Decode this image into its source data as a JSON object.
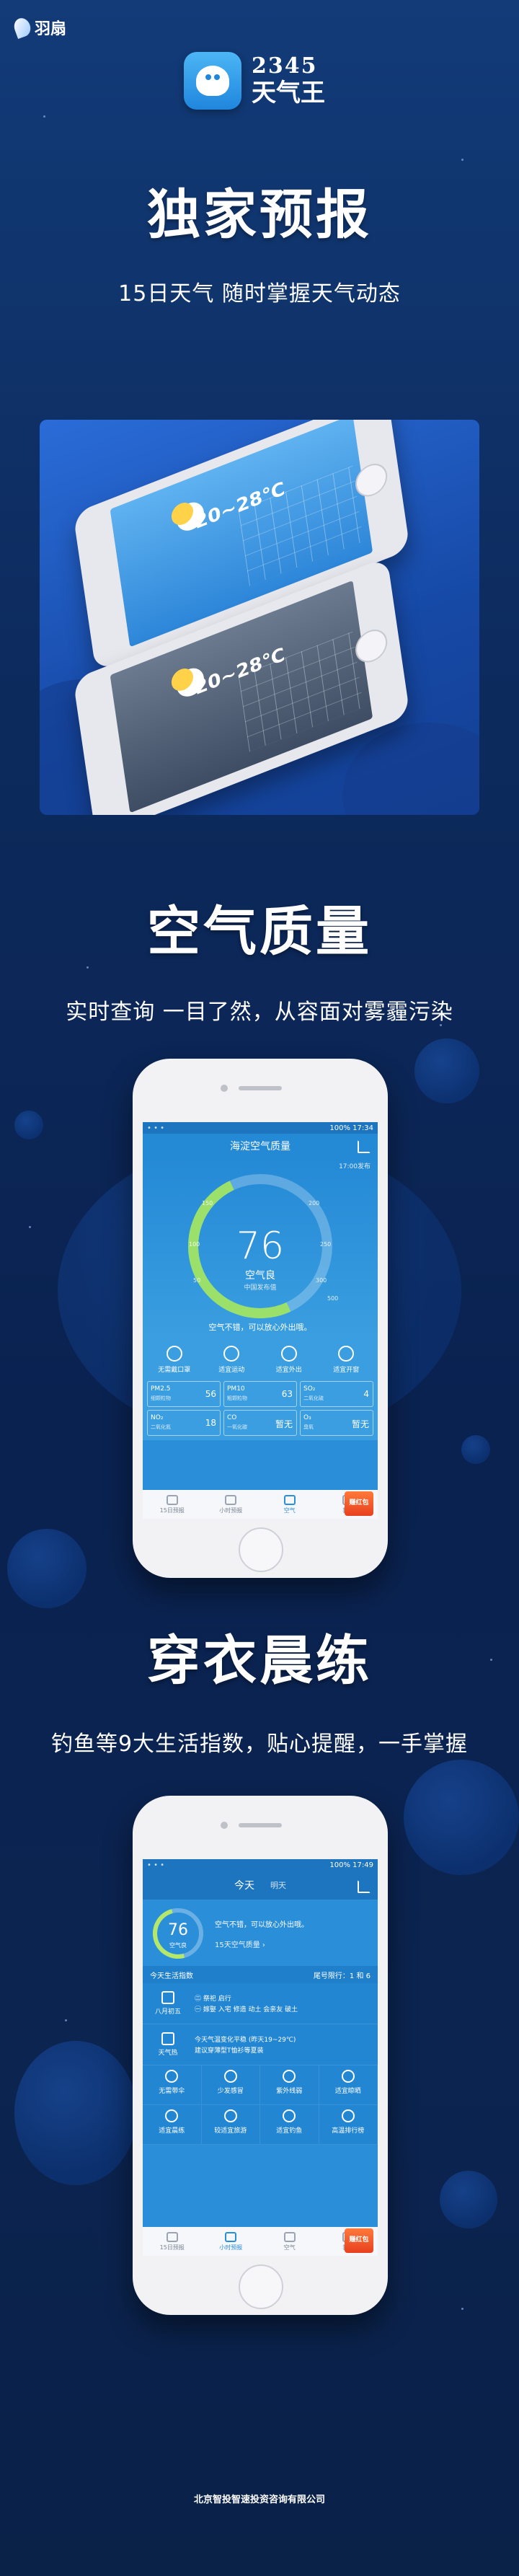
{
  "brand": {
    "name": "羽扇"
  },
  "app": {
    "name_num": "2345",
    "name_title": "天气王"
  },
  "sections": [
    {
      "title": "独家预报",
      "subtitle": "15日天气 随时掌握天气动态"
    },
    {
      "title": "空气质量",
      "subtitle": "实时查询  一目了然，从容面对雾霾污染"
    },
    {
      "title": "穿衣晨练",
      "subtitle": "钓鱼等9大生活指数，贴心提醒，一手掌握"
    }
  ],
  "forecast_mock": {
    "temp": "20~28℃"
  },
  "aq_screen": {
    "status_time": "100%  17:34",
    "title": "海淀空气质量",
    "updated": "17:00发布",
    "aqi": "76",
    "level": "空气良",
    "source": "中国发布值",
    "ticks": [
      "50",
      "100",
      "150",
      "200",
      "250",
      "300",
      "500"
    ],
    "note": "空气不错，可以放心外出哦。",
    "icons": [
      "无需戴口罩",
      "适宜运动",
      "适宜外出",
      "适宜开窗"
    ],
    "pollutants": [
      {
        "k": "PM2.5",
        "s": "细颗粒物",
        "v": "56"
      },
      {
        "k": "PM10",
        "s": "粗颗粒物",
        "v": "63"
      },
      {
        "k": "SO₂",
        "s": "二氧化硫",
        "v": "4"
      },
      {
        "k": "NO₂",
        "s": "二氧化氮",
        "v": "18"
      },
      {
        "k": "CO",
        "s": "一氧化碳",
        "v": "暂无"
      },
      {
        "k": "O₃",
        "s": "臭氧",
        "v": "暂无"
      }
    ],
    "tabs": [
      "15日预报",
      "小时预报",
      "空气",
      "我的"
    ],
    "badge": "赚红包"
  },
  "ls_screen": {
    "status_time": "100%  17:49",
    "tab_today": "今天",
    "tab_tomorrow": "明天",
    "aqi": "76",
    "level": "空气良",
    "note": "空气不错，可以放心外出哦。",
    "link": "15天空气质量 ›",
    "section_title": "今天生活指数",
    "section_right": "尾号限行：1 和 6",
    "rows": [
      {
        "left": "八月初五",
        "lines": [
          "㊁ 祭祀 启行",
          "㊀ 嫁娶 入宅 修造 动土 会亲友 破土"
        ]
      },
      {
        "left": "天气热",
        "lines": [
          "今天气温变化平稳 (昨天19~29℃)",
          "建议穿薄型T恤衫等夏装"
        ]
      }
    ],
    "grid": [
      "无需带伞",
      "少发感冒",
      "紫外线弱",
      "适宜晾晒",
      "适宜晨练",
      "较适宜旅游",
      "适宜钓鱼",
      "高温排行榜"
    ],
    "tabs": [
      "15日预报",
      "小时预报",
      "空气",
      "我的"
    ],
    "badge": "赚红包"
  },
  "footer": "北京智投智速投资咨询有限公司"
}
